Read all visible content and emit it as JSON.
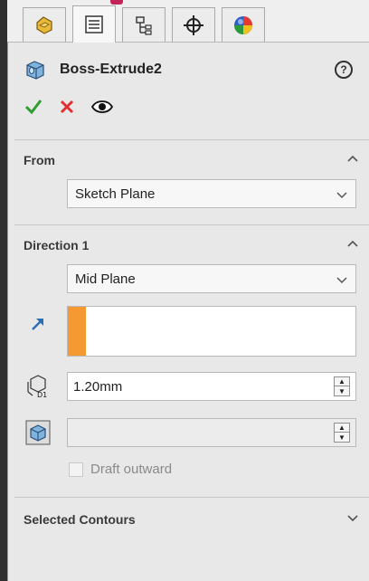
{
  "tabs": [
    {
      "name": "featuremanager",
      "icon": "hand-part-icon"
    },
    {
      "name": "propertymanager",
      "icon": "property-list-icon",
      "active": true
    },
    {
      "name": "configurationmanager",
      "icon": "config-tree-icon"
    },
    {
      "name": "dimxpert",
      "icon": "crosshair-icon"
    },
    {
      "name": "appearance",
      "icon": "color-ball-icon"
    }
  ],
  "header": {
    "title": "Boss-Extrude2",
    "help_label": "?"
  },
  "actions": {
    "ok_icon": "green-check-icon",
    "cancel_icon": "red-x-icon",
    "preview_icon": "eye-icon"
  },
  "from": {
    "title": "From",
    "value": "Sketch Plane"
  },
  "direction1": {
    "title": "Direction 1",
    "end_condition": "Mid Plane",
    "depth": "1.20mm",
    "draft_value": "",
    "draft_outward_label": "Draft outward"
  },
  "selected_contours": {
    "title": "Selected Contours"
  },
  "colors": {
    "accent_orange": "#f59a32",
    "ok_green": "#2e9e2e",
    "cancel_red": "#e03030"
  }
}
